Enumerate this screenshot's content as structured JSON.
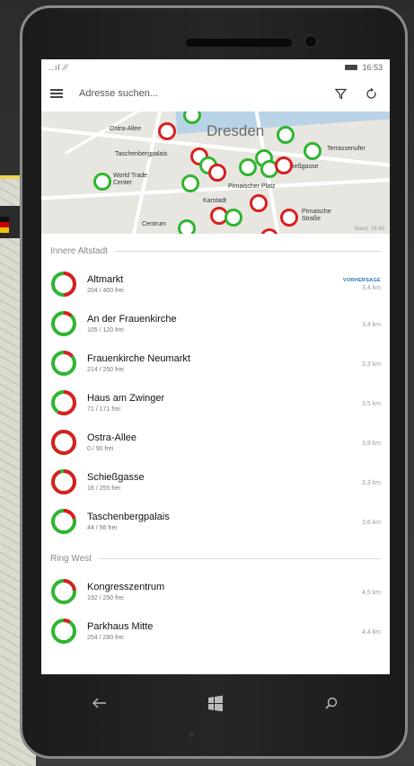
{
  "status": {
    "signal": "..ıl ⁄⁄",
    "time": "16:53"
  },
  "topbar": {
    "search_placeholder": "Adresse suchen..."
  },
  "map": {
    "city": "Dresden",
    "stamp": "Stand: 16:49",
    "labels": [
      "Ostra-Allee",
      "Taschenbergpalais",
      "World Trade Center",
      "Pirnaischer Platz",
      "Terrassenufer",
      "Schießgasse",
      "Karstadt",
      "Pirnaische Straße",
      "Centrum"
    ]
  },
  "sections": [
    {
      "title": "Innere Altstadt",
      "items": [
        {
          "name": "Altmarkt",
          "sub": "204 / 400 frei",
          "badge": "VORHERSAGE",
          "dist": "3,4 km",
          "occupancy": 0.49,
          "status": "red"
        },
        {
          "name": "An der Frauenkirche",
          "sub": "105 / 120 frei",
          "badge": "",
          "dist": "3,4 km",
          "occupancy": 0.12,
          "status": "green"
        },
        {
          "name": "Frauenkirche Neumarkt",
          "sub": "214 / 250 frei",
          "badge": "",
          "dist": "3,3 km",
          "occupancy": 0.14,
          "status": "green"
        },
        {
          "name": "Haus am Zwinger",
          "sub": "71 / 171 frei",
          "badge": "",
          "dist": "3,5 km",
          "occupancy": 0.58,
          "status": "red"
        },
        {
          "name": "Ostra-Allee",
          "sub": "0 / 90 frei",
          "badge": "",
          "dist": "3,9 km",
          "occupancy": 1.0,
          "status": "red"
        },
        {
          "name": "Schießgasse",
          "sub": "16 / 255 frei",
          "badge": "",
          "dist": "3,3 km",
          "occupancy": 0.94,
          "status": "red"
        },
        {
          "name": "Taschenbergpalais",
          "sub": "44 / 56 frei",
          "badge": "",
          "dist": "3,6 km",
          "occupancy": 0.21,
          "status": "green"
        }
      ]
    },
    {
      "title": "Ring West",
      "items": [
        {
          "name": "Kongresszentrum",
          "sub": "192 / 250 frei",
          "badge": "",
          "dist": "4,5 km",
          "occupancy": 0.23,
          "status": "green"
        },
        {
          "name": "Parkhaus Mitte",
          "sub": "254 / 280 frei",
          "badge": "",
          "dist": "4,4 km",
          "occupancy": 0.09,
          "status": "green"
        }
      ]
    }
  ],
  "colors": {
    "full": "#d82020",
    "free": "#2fb52f",
    "accent": "#2a6fb3"
  },
  "icons": [
    "hamburger-menu-icon",
    "filter-icon",
    "refresh-icon",
    "back-arrow-icon",
    "windows-start-icon",
    "search-icon"
  ]
}
